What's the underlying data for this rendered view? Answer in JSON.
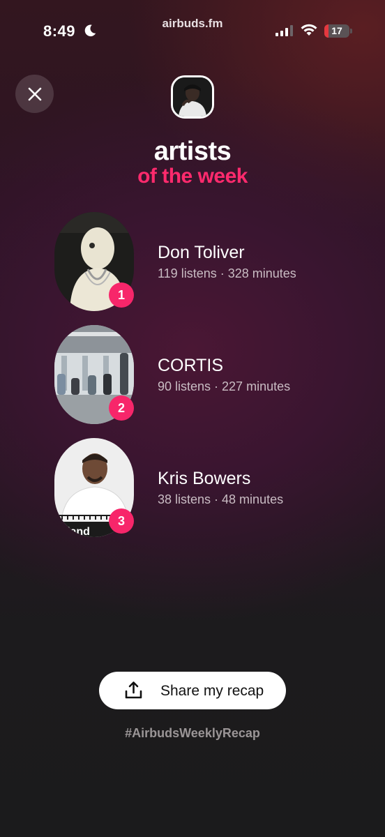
{
  "status_bar": {
    "time": "8:49",
    "url": "airbuds.fm",
    "battery_level": "17"
  },
  "header": {
    "title": "artists",
    "subtitle": "of the week",
    "accent_color": "#ff2a6d"
  },
  "artists": [
    {
      "rank": "1",
      "name": "Don Toliver",
      "stats": "119 listens · 328 minutes"
    },
    {
      "rank": "2",
      "name": "CORTIS",
      "stats": "90 listens · 227 minutes"
    },
    {
      "rank": "3",
      "name": "Kris Bowers",
      "stats": "38 listens · 48 minutes"
    }
  ],
  "share": {
    "label": "Share my recap",
    "hashtag": "#AirbudsWeeklyRecap"
  },
  "icons": [
    "moon-icon",
    "signal-icon",
    "wifi-icon",
    "battery-icon",
    "close-icon",
    "share-icon"
  ]
}
